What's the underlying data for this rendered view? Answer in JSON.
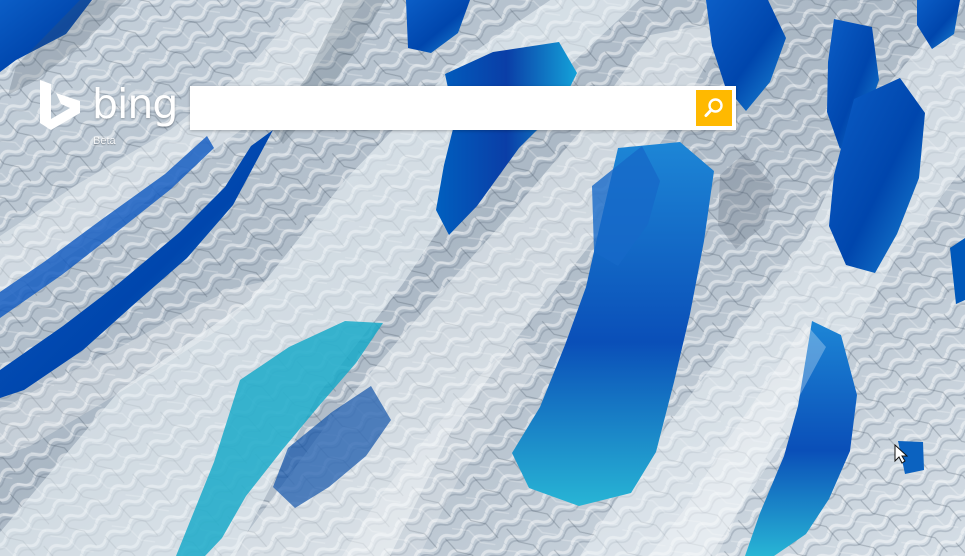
{
  "brand": {
    "name": "bing",
    "tag": "Beta"
  },
  "search": {
    "value": "",
    "placeholder": "",
    "button_icon": "search-icon",
    "accent_color": "#ffb900"
  },
  "background": {
    "subject": "aerial-glacier-meltwater-image"
  },
  "cursor": {
    "icon": "mouse-pointer-icon"
  }
}
